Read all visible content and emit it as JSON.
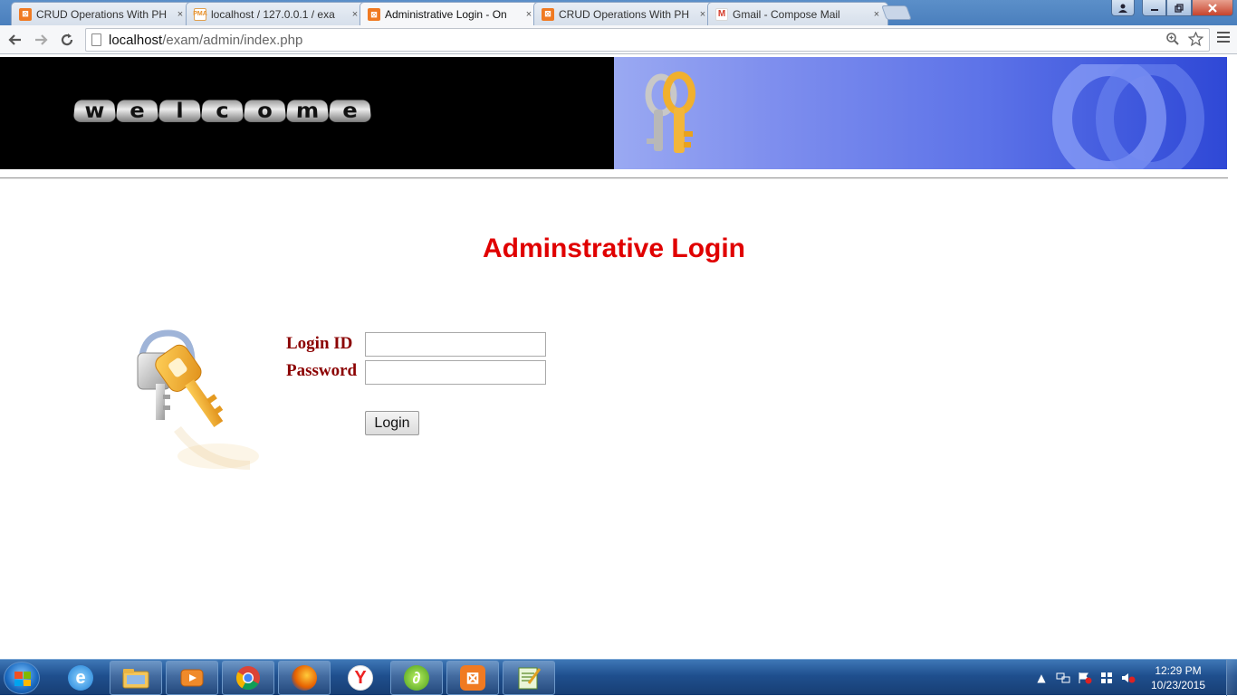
{
  "browser": {
    "tabs": [
      {
        "title": "CRUD Operations With PH",
        "icon": "xampp-icon",
        "active": false
      },
      {
        "title": "localhost / 127.0.0.1 / exa",
        "icon": "phpmyadmin-icon",
        "active": false
      },
      {
        "title": "Administrative Login - On",
        "icon": "xampp-icon",
        "active": true
      },
      {
        "title": "CRUD Operations With PH",
        "icon": "xampp-icon",
        "active": false
      },
      {
        "title": "Gmail - Compose Mail",
        "icon": "gmail-icon",
        "active": false
      }
    ],
    "tab_close_glyph": "×",
    "url_host": "localhost",
    "url_path": "/exam/admin/index.php"
  },
  "banner": {
    "welcome_letters": [
      "w",
      "e",
      "l",
      "c",
      "o",
      "m",
      "e"
    ]
  },
  "page": {
    "title": "Adminstrative Login",
    "form": {
      "login_id_label": "Login ID",
      "password_label": "Password",
      "login_id_value": "",
      "password_value": "",
      "login_button": "Login"
    }
  },
  "taskbar": {
    "time": "12:29 PM",
    "date": "10/23/2015",
    "pinned": [
      "internet-explorer-icon",
      "file-explorer-icon",
      "media-player-icon",
      "chrome-icon",
      "firefox-icon",
      "yandex-icon",
      "dreamweaver-icon",
      "xampp-icon",
      "notepad-icon"
    ]
  },
  "colors": {
    "title_red": "#e00000",
    "label_maroon": "#8b0000"
  }
}
